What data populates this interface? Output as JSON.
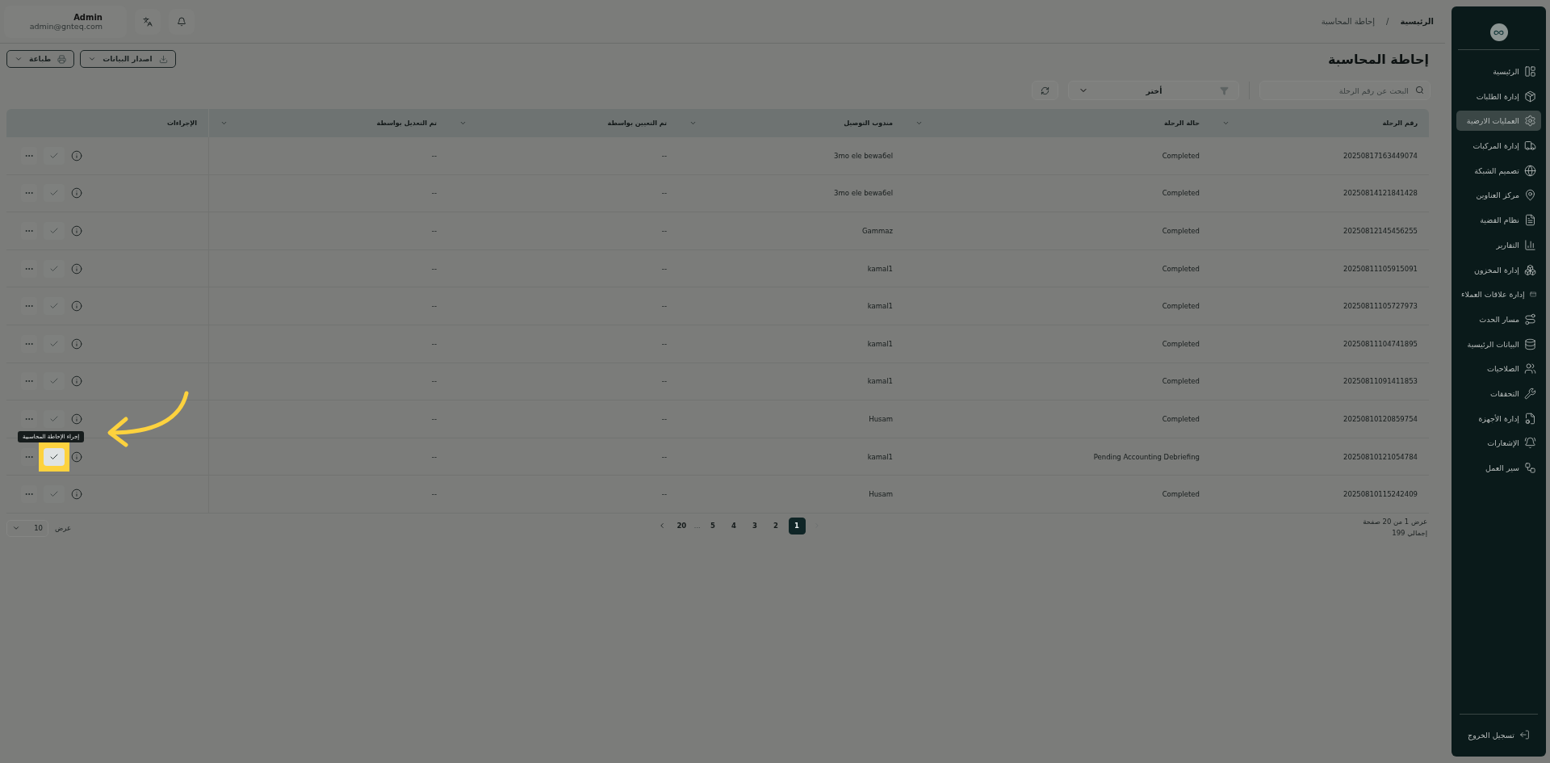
{
  "header": {
    "user": {
      "name": "Admin",
      "email": "admin@gnteq.com"
    }
  },
  "breadcrumb_separator": "/",
  "breadcrumb": [
    {
      "label": "الرئيسية",
      "current": false
    },
    {
      "label": "إحاطة المحاسبة",
      "current": true
    }
  ],
  "page_title": "إحاطة المحاسبة",
  "toolbar": {
    "export": "اصدار البيانات",
    "print": "طباعة"
  },
  "search": {
    "placeholder": "البحث عن رقم الرحلة"
  },
  "filter": {
    "value": "أختر"
  },
  "table": {
    "columns": [
      {
        "label": "رقم الرحلة",
        "sortable": true
      },
      {
        "label": "حالة الرحلة",
        "sortable": true
      },
      {
        "label": "مندوب التوصيل",
        "sortable": true
      },
      {
        "label": "تم التعيين بواسطة",
        "sortable": true
      },
      {
        "label": "تم التعديل بواسطة",
        "sortable": true
      },
      {
        "label": "الإجراءات",
        "sortable": false
      }
    ],
    "rows": [
      {
        "trip": "20250817163449074",
        "status": "Completed",
        "driver": "3mo ele bewa6el",
        "assigned_by": "--",
        "modified_by": "--",
        "highlighted": false
      },
      {
        "trip": "20250814121841428",
        "status": "Completed",
        "driver": "3mo ele bewa6el",
        "assigned_by": "--",
        "modified_by": "--",
        "highlighted": false
      },
      {
        "trip": "20250812145456255",
        "status": "Completed",
        "driver": "Gammaz",
        "assigned_by": "--",
        "modified_by": "--",
        "highlighted": false
      },
      {
        "trip": "20250811105915091",
        "status": "Completed",
        "driver": "kamal1",
        "assigned_by": "--",
        "modified_by": "--",
        "highlighted": false
      },
      {
        "trip": "20250811105727973",
        "status": "Completed",
        "driver": "kamal1",
        "assigned_by": "--",
        "modified_by": "--",
        "highlighted": false
      },
      {
        "trip": "20250811104741895",
        "status": "Completed",
        "driver": "kamal1",
        "assigned_by": "--",
        "modified_by": "--",
        "highlighted": false
      },
      {
        "trip": "20250811091411853",
        "status": "Completed",
        "driver": "kamal1",
        "assigned_by": "--",
        "modified_by": "--",
        "highlighted": false
      },
      {
        "trip": "20250810120859754",
        "status": "Completed",
        "driver": "Husam",
        "assigned_by": "--",
        "modified_by": "--",
        "highlighted": false
      },
      {
        "trip": "20250810121054784",
        "status": "Pending Accounting Debriefing",
        "driver": "kamal1",
        "assigned_by": "--",
        "modified_by": "--",
        "highlighted": true
      },
      {
        "trip": "20250810115242409",
        "status": "Completed",
        "driver": "Husam",
        "assigned_by": "--",
        "modified_by": "--",
        "highlighted": false
      }
    ]
  },
  "tooltip": "إجراء الإحاطة المحاسبية",
  "pagination": {
    "prev_disabled": true,
    "next_disabled": false,
    "pages": [
      {
        "kind": "page",
        "label": "1",
        "selected": true
      },
      {
        "kind": "page",
        "label": "2",
        "selected": false
      },
      {
        "kind": "page",
        "label": "3",
        "selected": false
      },
      {
        "kind": "page",
        "label": "4",
        "selected": false
      },
      {
        "kind": "page",
        "label": "5",
        "selected": false
      },
      {
        "kind": "ellipsis",
        "label": "..."
      },
      {
        "kind": "page",
        "label": "20",
        "selected": false
      }
    ],
    "page_size_label": "عرض",
    "page_size": "10",
    "summary": "عرض 1 من 20 صفحة",
    "total": "إجمالي 199"
  },
  "sidebar": {
    "items": [
      {
        "label": "الرئيسية",
        "selected": false
      },
      {
        "label": "إدارة الطلبات",
        "selected": false
      },
      {
        "label": "العمليات الارضية",
        "selected": true
      },
      {
        "label": "إدارة المركبات",
        "selected": false
      },
      {
        "label": "تصميم الشبكة",
        "selected": false
      },
      {
        "label": "مركز العناوين",
        "selected": false
      },
      {
        "label": "نظام القضية",
        "selected": false
      },
      {
        "label": "التقارير",
        "selected": false
      },
      {
        "label": "إدارة المخزون",
        "selected": false
      },
      {
        "label": "إدارة علاقات العملاء",
        "selected": false
      },
      {
        "label": "مسار الحدث",
        "selected": false
      },
      {
        "label": "البيانات الرئيسية",
        "selected": false
      },
      {
        "label": "الصلاحيات",
        "selected": false
      },
      {
        "label": "التحققات",
        "selected": false
      },
      {
        "label": "إدارة الأجهزة",
        "selected": false
      },
      {
        "label": "الإشعارات",
        "selected": false
      },
      {
        "label": "سير العمل",
        "selected": false
      }
    ],
    "logout": "تسجيل الخروج"
  }
}
